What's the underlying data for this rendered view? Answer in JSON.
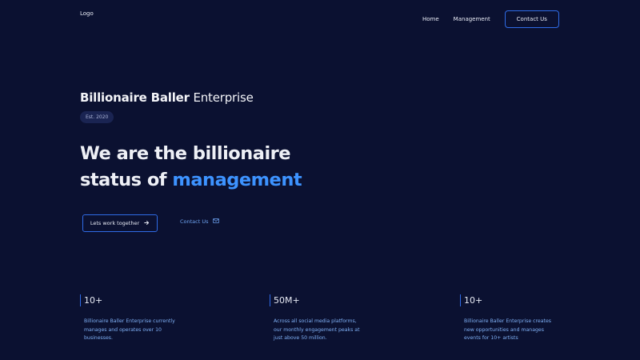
{
  "header": {
    "logo": "Logo",
    "nav": [
      {
        "label": "Home"
      },
      {
        "label": "Management"
      }
    ],
    "contact_label": "Contact Us"
  },
  "hero": {
    "brand_bold": "Billionaire Baller",
    "brand_light": "Enterprise",
    "badge": "Est. 2020",
    "headline_line1": "We are the billionaire",
    "headline_line2_prefix": "status of",
    "headline_accent": "management",
    "primary_cta": "Lets work together",
    "secondary_cta": "Contact Us"
  },
  "stats": [
    {
      "value": "10+",
      "desc_lines": [
        "Billionaire Baller Enterprise currently",
        "manages and operates over 10",
        "businesses."
      ]
    },
    {
      "value": "50M+",
      "desc_lines": [
        "Across all social media platforms,",
        "our monthly engagement peaks at",
        "just above 50 million."
      ]
    },
    {
      "value": "10+",
      "desc_lines": [
        "Billionaire Baller Enterprise creates",
        "new opportunities and manages",
        "events for 10+ artists"
      ]
    }
  ],
  "colors": {
    "background": "#0b1131",
    "accent": "#3d93ff",
    "border": "#2f6be6",
    "stat_text": "#7fb0f5"
  }
}
